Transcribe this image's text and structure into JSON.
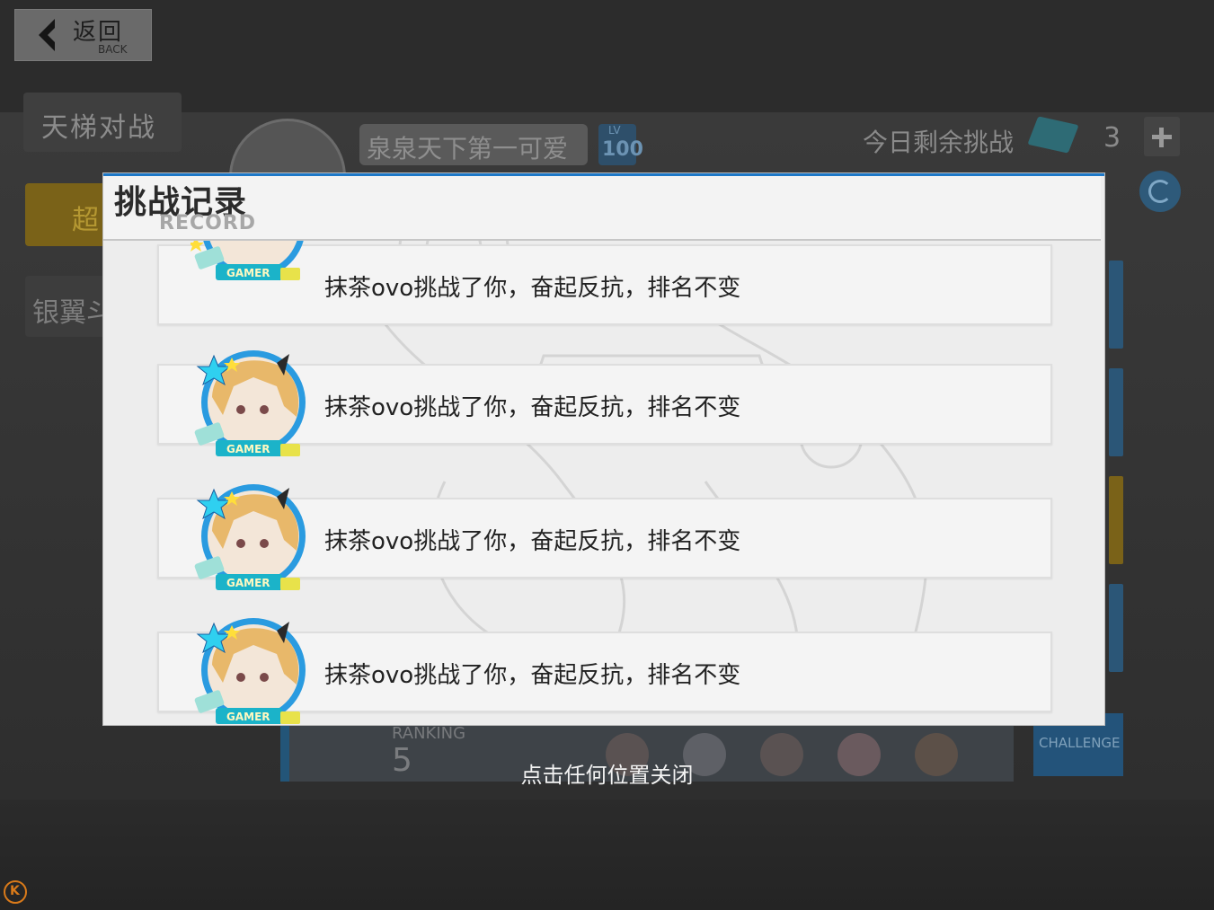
{
  "header": {
    "back_cn": "返回",
    "back_en": "BACK"
  },
  "tabs": {
    "ladder": "天梯对战",
    "super": "超",
    "silver": "银翼斗"
  },
  "player": {
    "name": "泉泉天下第一可爱",
    "lv_label": "LV",
    "level": "100"
  },
  "daily": {
    "label": "今日剩余挑战",
    "count": "3"
  },
  "ranking": {
    "label": "RANKING",
    "value": "5"
  },
  "challenge_label": "CHALLENGE",
  "modal": {
    "title": "挑战记录",
    "subtitle": "RECORD",
    "records": [
      {
        "text": "抹茶ovo挑战了你，奋起反抗，排名不变",
        "badge": "GAMER"
      },
      {
        "text": "抹茶ovo挑战了你，奋起反抗，排名不变",
        "badge": "GAMER"
      },
      {
        "text": "抹茶ovo挑战了你，奋起反抗，排名不变",
        "badge": "GAMER"
      },
      {
        "text": "抹茶ovo挑战了你，奋起反抗，排名不变",
        "badge": "GAMER"
      }
    ]
  },
  "close_hint": "点击任何位置关闭",
  "corner_badge": "K",
  "colors": {
    "modal_accent": "#1d78c8",
    "avatar_ring": "#2a9be0",
    "avatar_hair": "#e8b86a"
  }
}
